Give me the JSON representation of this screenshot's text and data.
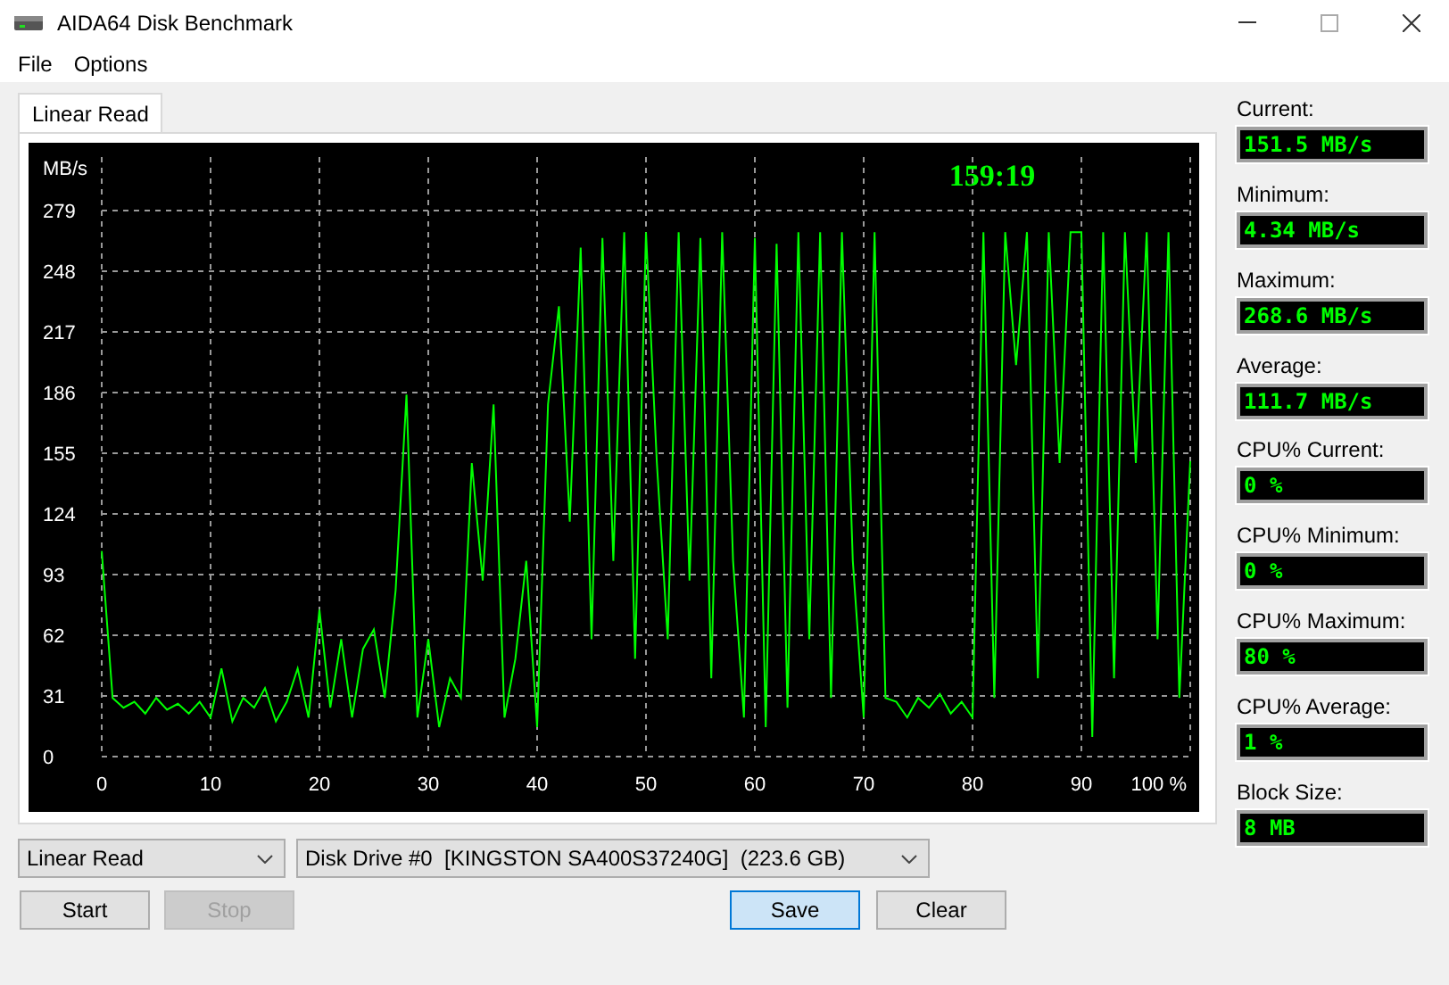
{
  "window": {
    "title": "AIDA64 Disk Benchmark"
  },
  "menu": [
    "File",
    "Options"
  ],
  "tabs": [
    {
      "label": "Linear Read",
      "selected": true
    }
  ],
  "chart_panel": {
    "elapsed": "159:19",
    "chart_data": {
      "type": "line",
      "grid": true,
      "ylabel": "MB/s",
      "xlim": [
        0,
        100
      ],
      "ylim": [
        0,
        279
      ],
      "yticks": [
        0,
        31,
        62,
        93,
        124,
        155,
        186,
        217,
        248,
        279
      ],
      "xticks": [
        0,
        10,
        20,
        30,
        40,
        50,
        60,
        70,
        80,
        90,
        {
          "value": 100,
          "label": "100 %"
        }
      ],
      "x": [
        0,
        1,
        2,
        3,
        4,
        5,
        6,
        7,
        8,
        9,
        10,
        11,
        12,
        13,
        14,
        15,
        16,
        17,
        18,
        19,
        20,
        21,
        22,
        23,
        24,
        25,
        26,
        27,
        28,
        29,
        30,
        31,
        32,
        33,
        34,
        35,
        36,
        37,
        38,
        39,
        40,
        41,
        42,
        43,
        44,
        45,
        46,
        47,
        48,
        49,
        50,
        51,
        52,
        53,
        54,
        55,
        56,
        57,
        58,
        59,
        60,
        61,
        62,
        63,
        64,
        65,
        66,
        67,
        68,
        69,
        70,
        71,
        72,
        73,
        74,
        75,
        76,
        77,
        78,
        79,
        80,
        81,
        82,
        83,
        84,
        85,
        86,
        87,
        88,
        89,
        90,
        91,
        92,
        93,
        94,
        95,
        96,
        97,
        98,
        99,
        100
      ],
      "series": [
        {
          "color": "#00ff00",
          "values": [
            105,
            30,
            25,
            28,
            22,
            30,
            24,
            27,
            22,
            28,
            20,
            45,
            18,
            30,
            25,
            35,
            18,
            28,
            45,
            20,
            75,
            25,
            60,
            20,
            55,
            65,
            30,
            85,
            185,
            20,
            60,
            15,
            40,
            30,
            150,
            90,
            180,
            20,
            50,
            100,
            15,
            180,
            230,
            120,
            260,
            60,
            265,
            100,
            268,
            50,
            268,
            150,
            60,
            268,
            90,
            265,
            40,
            268,
            100,
            20,
            265,
            15,
            262,
            25,
            268,
            60,
            268,
            30,
            268,
            100,
            20,
            268,
            30,
            28,
            20,
            30,
            25,
            32,
            22,
            28,
            20,
            268,
            30,
            268,
            200,
            268,
            40,
            268,
            150,
            268,
            268,
            10,
            268,
            40,
            268,
            150,
            268,
            60,
            268,
            30,
            151
          ]
        }
      ]
    }
  },
  "stat_groups": [
    {
      "items": [
        {
          "label": "Current:",
          "value": "151.5 MB/s"
        },
        {
          "label": "Minimum:",
          "value": "4.34 MB/s"
        },
        {
          "label": "Maximum:",
          "value": "268.6 MB/s"
        },
        {
          "label": "Average:",
          "value": "111.7 MB/s"
        }
      ]
    },
    {
      "items": [
        {
          "label": "CPU% Current:",
          "value": "0 %"
        },
        {
          "label": "CPU% Minimum:",
          "value": "0 %"
        },
        {
          "label": "CPU% Maximum:",
          "value": "80 %"
        },
        {
          "label": "CPU% Average:",
          "value": "1 %"
        },
        {
          "label": "Block Size:",
          "value": "8 MB"
        }
      ]
    }
  ],
  "selectors": [
    {
      "value": "Linear Read"
    },
    {
      "value": "Disk Drive #0  [KINGSTON SA400S37240G]  (223.6 GB)"
    }
  ],
  "buttons": [
    {
      "label": "Start",
      "disabled": false,
      "default": false
    },
    {
      "label": "Stop",
      "disabled": true,
      "default": false
    },
    {
      "label": "Save",
      "disabled": false,
      "default": true
    },
    {
      "label": "Clear",
      "disabled": false,
      "default": false
    }
  ]
}
